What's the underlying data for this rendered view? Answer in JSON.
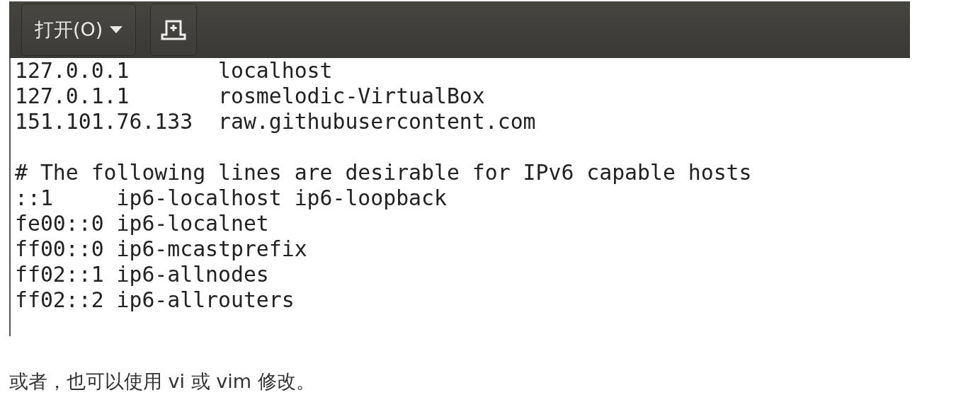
{
  "toolbar": {
    "open_button": {
      "label": "打开(O)"
    }
  },
  "editor": {
    "blocks": [
      [
        "127.0.0.1       localhost",
        "127.0.1.1       rosmelodic-VirtualBox",
        "151.101.76.133  raw.githubusercontent.com"
      ],
      [
        "# The following lines are desirable for IPv6 capable hosts",
        "::1     ip6-localhost ip6-loopback",
        "fe00::0 ip6-localnet",
        "ff00::0 ip6-mcastprefix",
        "ff02::1 ip6-allnodes",
        "ff02::2 ip6-allrouters"
      ]
    ]
  },
  "caption": "或者，也可以使用 vi 或 vim 修改。"
}
